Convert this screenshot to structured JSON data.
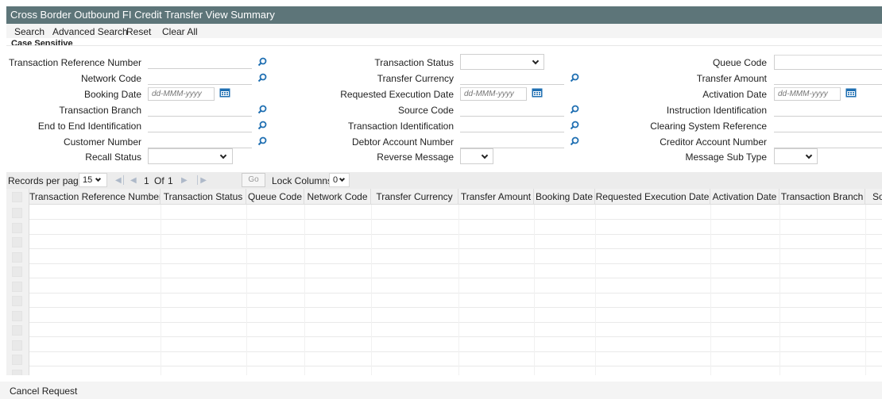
{
  "title": "Cross Border Outbound FI Credit Transfer View Summary",
  "toolbar": {
    "search": "Search",
    "advanced_search": "Advanced Search",
    "reset": "Reset",
    "clear_all": "Clear All"
  },
  "case_sensitive": "Case Sensitive",
  "form": {
    "col1": {
      "transaction_reference_number": "Transaction Reference Number",
      "network_code": "Network Code",
      "booking_date": "Booking Date",
      "transaction_branch": "Transaction Branch",
      "end_to_end_identification": "End to End Identification",
      "customer_number": "Customer Number",
      "recall_status": "Recall Status"
    },
    "col2": {
      "transaction_status": "Transaction Status",
      "transfer_currency": "Transfer Currency",
      "requested_execution_date": "Requested Execution Date",
      "source_code": "Source Code",
      "transaction_identification": "Transaction Identification",
      "debtor_account_number": "Debtor Account Number",
      "reverse_message": "Reverse Message"
    },
    "col3": {
      "queue_code": "Queue Code",
      "transfer_amount": "Transfer Amount",
      "activation_date": "Activation Date",
      "instruction_identification": "Instruction Identification",
      "clearing_system_reference": "Clearing System Reference",
      "creditor_account_number": "Creditor Account Number",
      "message_sub_type": "Message Sub Type"
    },
    "date_placeholder": "dd-MMM-yyyy"
  },
  "pager": {
    "records_per_page_label": "Records per page",
    "records_per_page_value": "15",
    "current_page": "1",
    "of_label": "Of",
    "total_pages": "1",
    "go_label": "Go",
    "lock_columns_label": "Lock Columns",
    "lock_columns_value": "0"
  },
  "grid": {
    "columns": [
      "Transaction Reference Number",
      "Transaction Status",
      "Queue Code",
      "Network Code",
      "Transfer Currency",
      "Transfer Amount",
      "Booking Date",
      "Requested Execution Date",
      "Activation Date",
      "Transaction Branch",
      "So"
    ],
    "row_count": 12
  },
  "footer": {
    "cancel_request": "Cancel Request"
  },
  "colors": {
    "title_bg": "#5d7579",
    "icon_blue": "#1f6fb2"
  }
}
